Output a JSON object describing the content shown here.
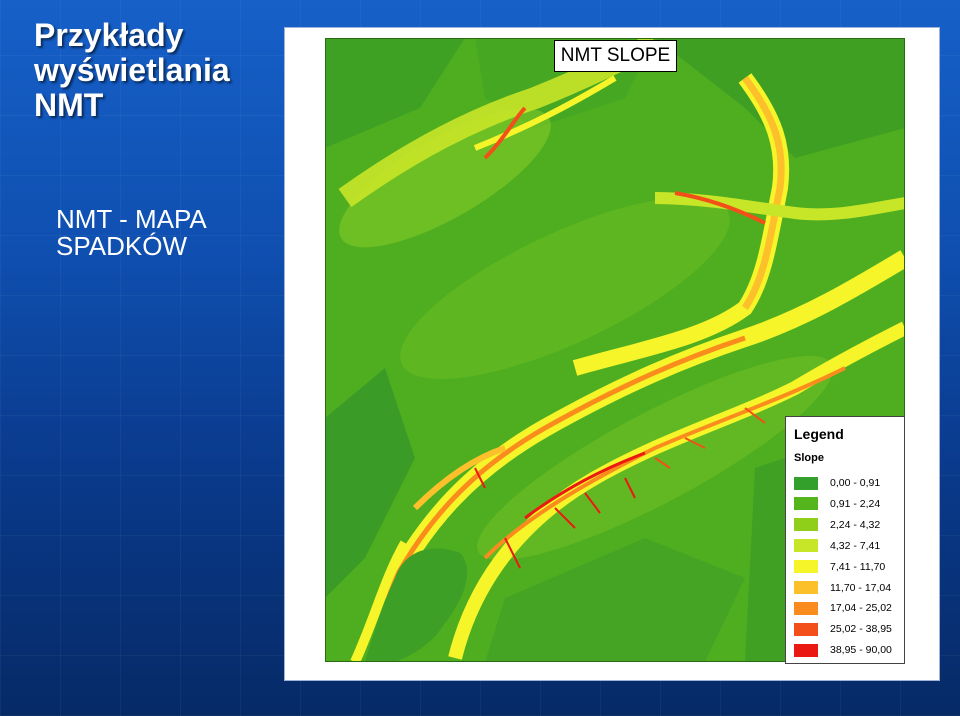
{
  "slide": {
    "title_lines": [
      "Przykłady",
      "wyświetlania",
      "NMT"
    ],
    "subtitle_lines": [
      "NMT - MAPA",
      "SPADKÓW"
    ]
  },
  "map": {
    "title": "NMT SLOPE",
    "legend": {
      "heading": "Legend",
      "subheading": "Slope",
      "items": [
        {
          "label": "0,00 - 0,91",
          "color": "#33a02c"
        },
        {
          "label": "0,91 - 2,24",
          "color": "#55b51c"
        },
        {
          "label": "2,24 - 4,32",
          "color": "#8fcf1a"
        },
        {
          "label": "4,32 - 7,41",
          "color": "#c8e628"
        },
        {
          "label": "7,41 - 11,70",
          "color": "#f5f52a"
        },
        {
          "label": "11,70 - 17,04",
          "color": "#fcc02a"
        },
        {
          "label": "17,04 - 25,02",
          "color": "#fa8c1e"
        },
        {
          "label": "25,02 - 38,95",
          "color": "#f25018"
        },
        {
          "label": "38,95 - 90,00",
          "color": "#ea1a12"
        }
      ]
    }
  }
}
